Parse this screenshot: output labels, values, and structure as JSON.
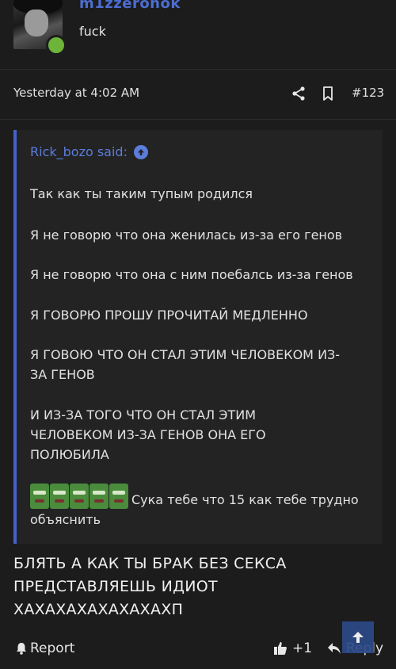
{
  "author": {
    "username": "m1zzeronok",
    "title": "fuck"
  },
  "post": {
    "date": "Yesterday at 4:02 AM",
    "number": "#123"
  },
  "quote": {
    "header": "Rick_bozo said:",
    "lines": [
      "Так как ты таким тупым родился",
      "Я не говорю что она женилась из-за его генов",
      "Я не говорю что она с ним поебалсь из-за генов",
      "Я ГОВОРЮ ПРОШУ ПРОЧИТАЙ МЕДЛЕННО",
      "Я ГОВОЮ ЧТО ОН СТАЛ ЭТИМ ЧЕЛОВЕКОМ ИЗ-ЗА ГЕНОВ",
      "И ИЗ-ЗА ТОГО ЧТО ОН СТАЛ ЭТИМ ЧЕЛОВЕКОМ ИЗ-ЗА ГЕНОВ ОНА ЕГО ПОЛЮБИЛА"
    ],
    "last_text": "Сука тебе что 15 как тебе трудно объяснить"
  },
  "message": "БЛЯТЬ А КАК ТЫ БРАК БЕЗ СЕКСА ПРЕДСТАВЛЯЕШЬ ИДИОТ ХАХАХАХАХАХАХАХП",
  "actions": {
    "report": "Report",
    "like_count": "+1",
    "reply": "Reply"
  },
  "colors": {
    "accent": "#4c6ed1",
    "online": "#6cb43a",
    "background": "#1c1c1d"
  }
}
